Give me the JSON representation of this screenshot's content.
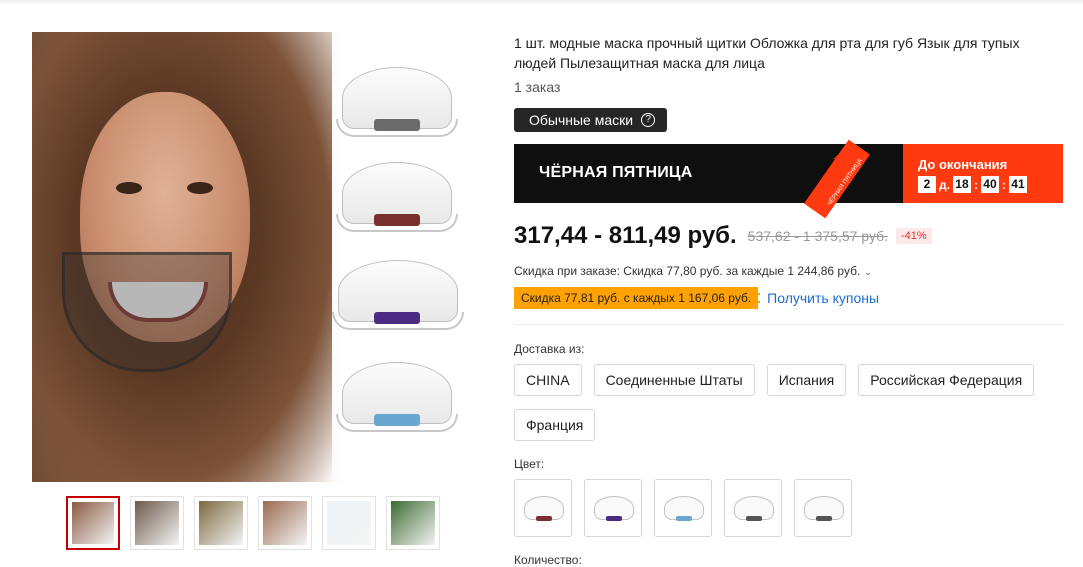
{
  "product": {
    "title": "1 шт. модные маска прочный щитки Обложка для рта для губ Язык для тупых людей Пылезащитная маска для лица",
    "orders": "1 заказ",
    "variant_chip": "Обычные маски"
  },
  "promo": {
    "banner_title": "ЧЁРНАЯ ПЯТНИЦА",
    "stripe_text": "ЧЁРНАЯ ПЯТНИЦА",
    "countdown_label": "До окончания",
    "days": "2",
    "days_unit": "д.",
    "hours": "18",
    "minutes": "40",
    "seconds": "41"
  },
  "pricing": {
    "price": "317,44 - 811,49 руб.",
    "old_price": "537,62 - 1 375,57 руб.",
    "discount": "-41%",
    "order_discount": "Скидка при заказе: Скидка 77,80 руб. за каждые 1 244,86 руб.",
    "coupon_badge": "Скидка 77,81 руб. с каждых 1 167,06 руб.",
    "coupon_link": "Получить купоны"
  },
  "shipping": {
    "label": "Доставка из:",
    "options": [
      "CHINA",
      "Соединенные Штаты",
      "Испания",
      "Российская Федерация",
      "Франция"
    ]
  },
  "color": {
    "label": "Цвет:",
    "swatch_strip_colors": [
      "#7a2f2f",
      "#4b2a84",
      "#6aa7d0",
      "#555555",
      "#555555"
    ]
  },
  "quantity": {
    "label": "Количество:"
  },
  "gallery": {
    "shield_strip_colors": [
      "#6b6b6b",
      "#7a2f2f",
      "#4b2a84",
      "#6aa7d0"
    ],
    "thumb_colors": [
      "#8a5a42",
      "#6c5a4a",
      "#7b6a40",
      "#9b6b50",
      "#eef2f6",
      "#3d6b32"
    ]
  },
  "colors": {
    "accent": "#ff3a10",
    "coupon": "#ffa100",
    "link": "#1c6fd1",
    "discount_text": "#e43131"
  }
}
